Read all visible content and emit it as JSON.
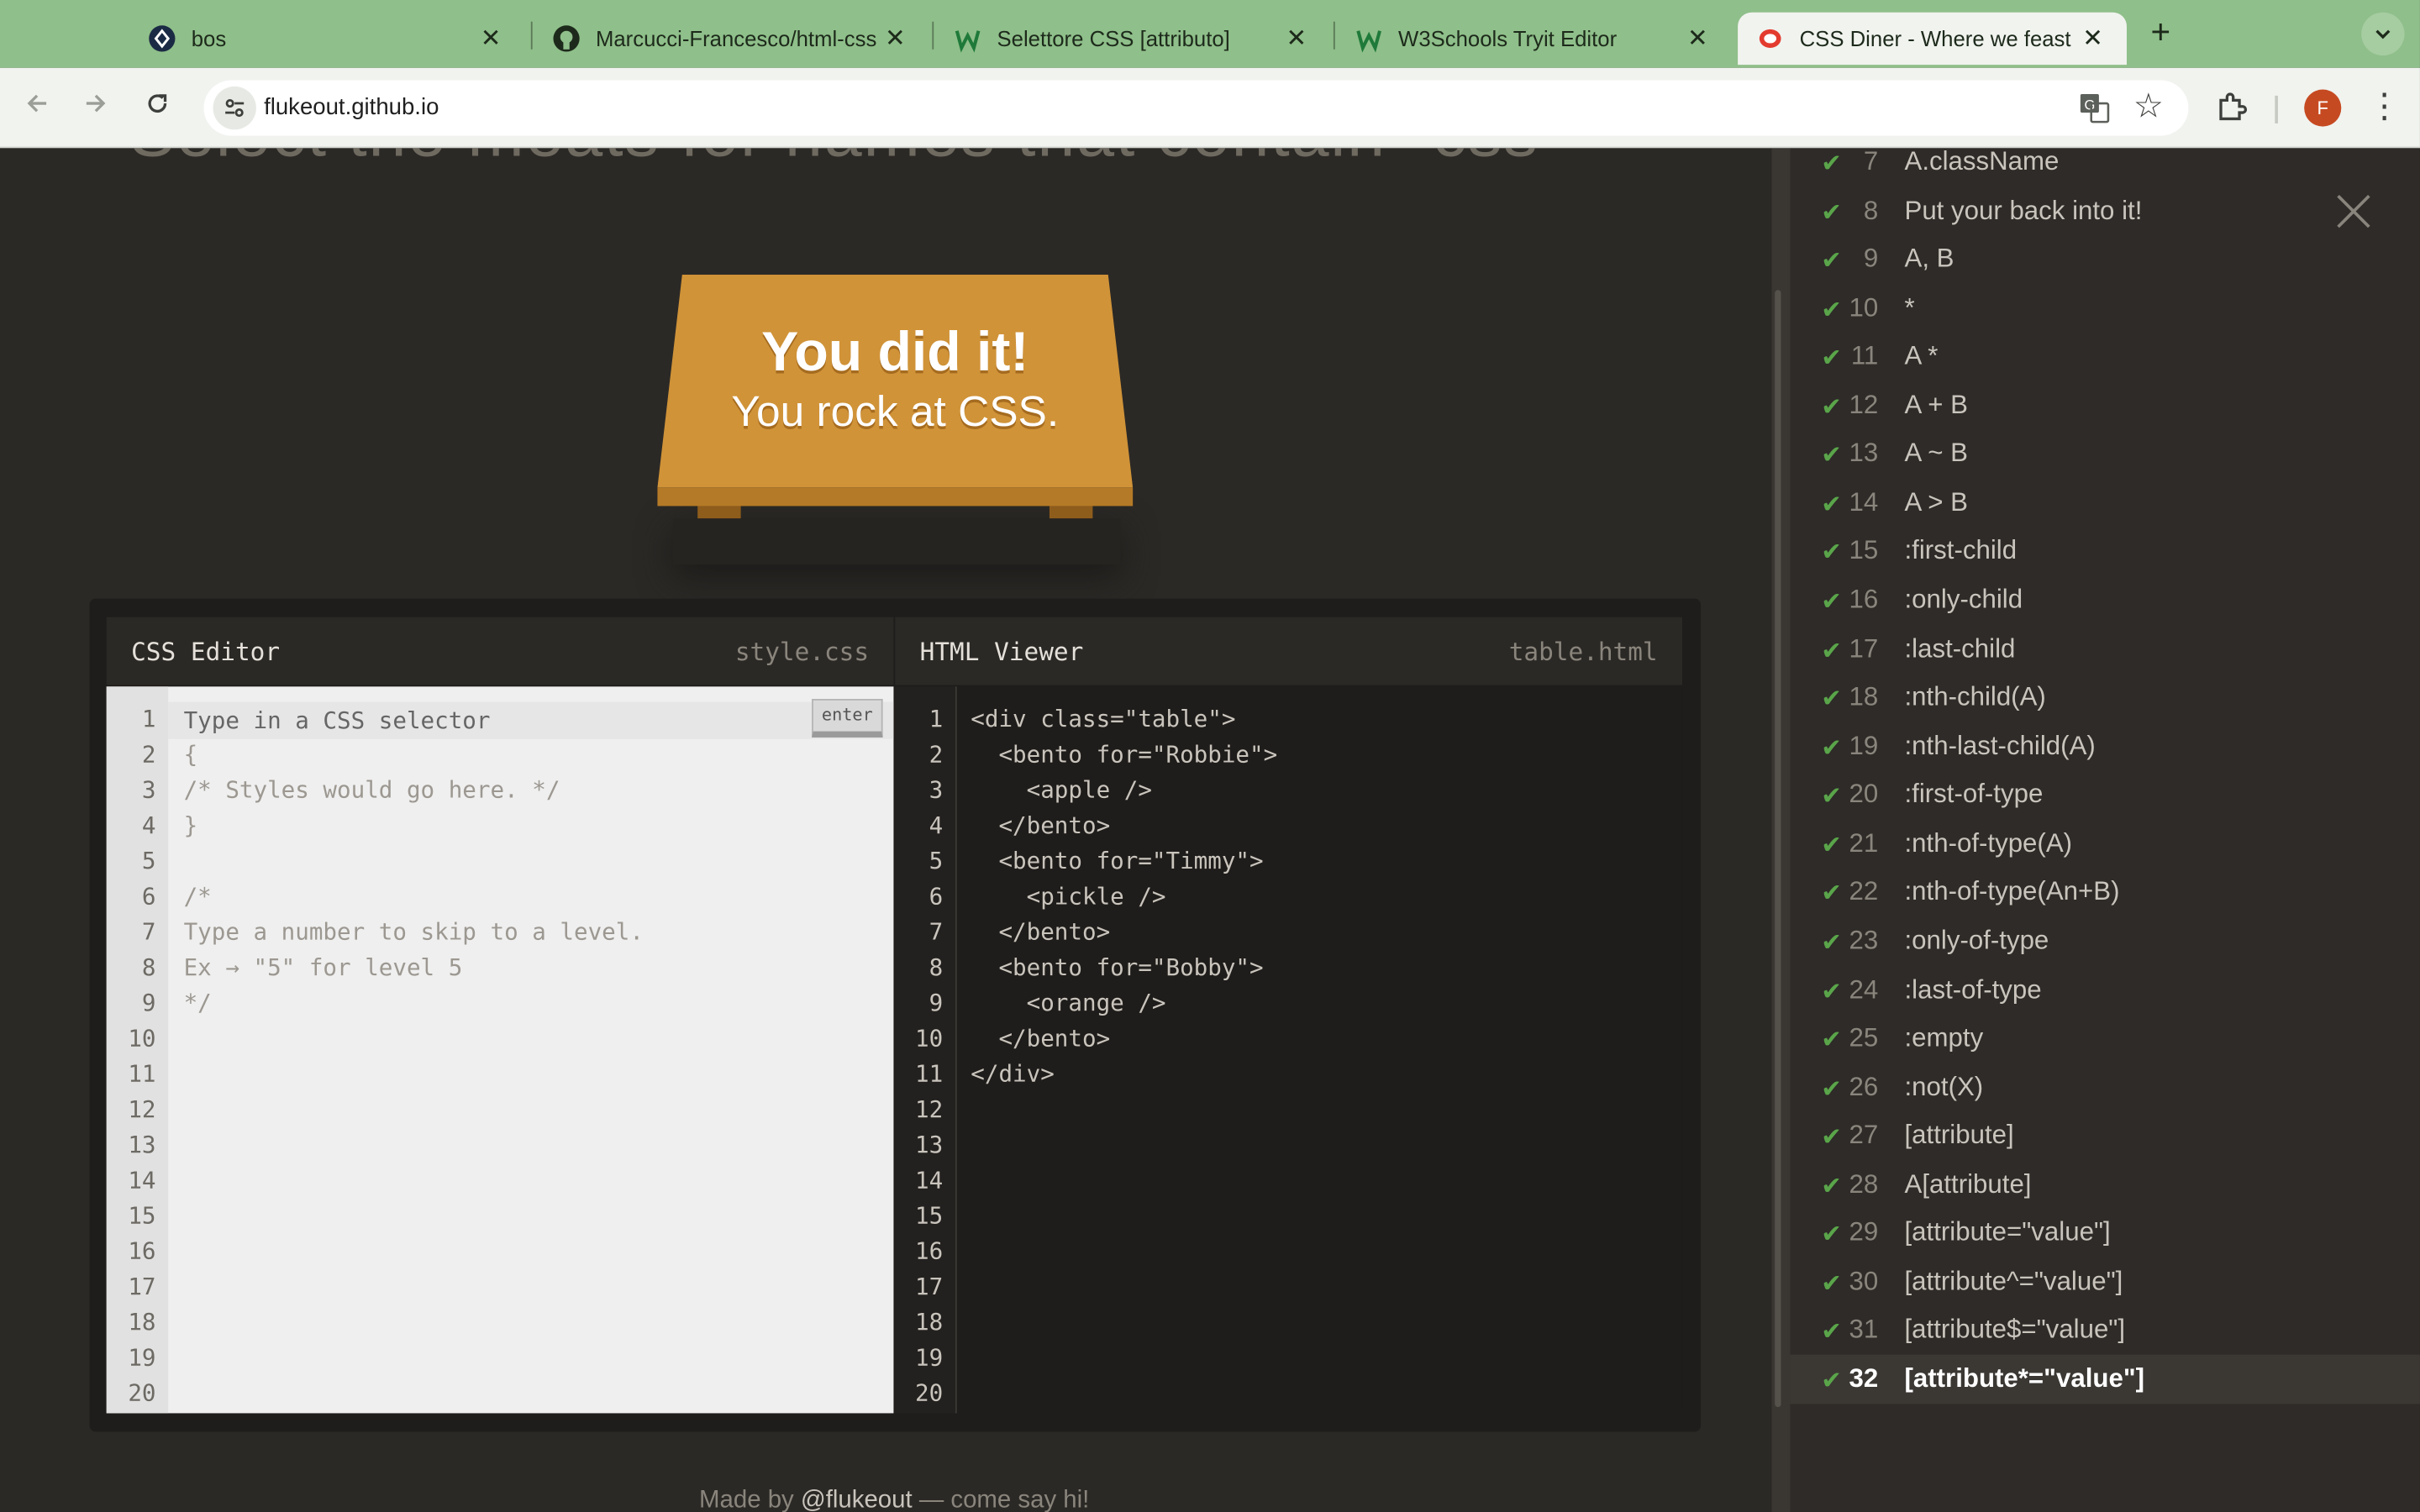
{
  "browser": {
    "tabs": [
      {
        "title": "bos",
        "active": false,
        "favicon": "bos-diamond-icon"
      },
      {
        "title": "Marcucci-Francesco/html-css",
        "active": false,
        "favicon": "github-icon"
      },
      {
        "title": "Selettore CSS [attributo]",
        "active": false,
        "favicon": "w3schools-icon"
      },
      {
        "title": "W3Schools Tryit Editor",
        "active": false,
        "favicon": "w3schools-icon"
      },
      {
        "title": "CSS Diner - Where we feast on",
        "active": true,
        "favicon": "css-diner-icon"
      }
    ],
    "close_glyph": "✕",
    "new_tab_glyph": "+",
    "url": "flukeout.github.io",
    "avatar_initial": "F",
    "colors": {
      "tabstrip": "#8fbf8a",
      "toolbar": "#f1f3ef",
      "avatar": "#c64a21"
    }
  },
  "page": {
    "order_instruction": "Select the meats for names that contain \"css\"",
    "table": {
      "line1": "You did it!",
      "line2": "You rock at CSS."
    },
    "css_editor": {
      "title": "CSS Editor",
      "filename": "style.css",
      "input_placeholder": "Type in a CSS selector",
      "enter_label": "enter",
      "lines": [
        "",
        "{",
        "/* Styles would go here. */",
        "}",
        "",
        "/*",
        "Type a number to skip to a level.",
        "Ex → \"5\" for level 5",
        "*/"
      ],
      "line_count": 20
    },
    "html_viewer": {
      "title": "HTML Viewer",
      "filename": "table.html",
      "lines": [
        "<div class=\"table\">",
        "  <bento for=\"Robbie\">",
        "    <apple />",
        "  </bento>",
        "  <bento for=\"Timmy\">",
        "    <pickle />",
        "  </bento>",
        "  <bento for=\"Bobby\">",
        "    <orange />",
        "  </bento>",
        "</div>"
      ],
      "line_count": 20
    },
    "footer": {
      "prefix": "Made by ",
      "author": "@flukeout",
      "suffix": " — come say hi!"
    }
  },
  "levels": {
    "current": 32,
    "items": [
      {
        "num": "7",
        "name": "A.className",
        "done": true
      },
      {
        "num": "8",
        "name": "Put your back into it!",
        "done": true
      },
      {
        "num": "9",
        "name": "A, B",
        "done": true
      },
      {
        "num": "10",
        "name": "*",
        "done": true
      },
      {
        "num": "11",
        "name": "A *",
        "done": true
      },
      {
        "num": "12",
        "name": "A + B",
        "done": true
      },
      {
        "num": "13",
        "name": "A ~ B",
        "done": true
      },
      {
        "num": "14",
        "name": "A > B",
        "done": true
      },
      {
        "num": "15",
        "name": ":first-child",
        "done": true
      },
      {
        "num": "16",
        "name": ":only-child",
        "done": true
      },
      {
        "num": "17",
        "name": ":last-child",
        "done": true
      },
      {
        "num": "18",
        "name": ":nth-child(A)",
        "done": true
      },
      {
        "num": "19",
        "name": ":nth-last-child(A)",
        "done": true
      },
      {
        "num": "20",
        "name": ":first-of-type",
        "done": true
      },
      {
        "num": "21",
        "name": ":nth-of-type(A)",
        "done": true
      },
      {
        "num": "22",
        "name": ":nth-of-type(An+B)",
        "done": true
      },
      {
        "num": "23",
        "name": ":only-of-type",
        "done": true
      },
      {
        "num": "24",
        "name": ":last-of-type",
        "done": true
      },
      {
        "num": "25",
        "name": ":empty",
        "done": true
      },
      {
        "num": "26",
        "name": ":not(X)",
        "done": true
      },
      {
        "num": "27",
        "name": "[attribute]",
        "done": true
      },
      {
        "num": "28",
        "name": "A[attribute]",
        "done": true
      },
      {
        "num": "29",
        "name": "[attribute=\"value\"]",
        "done": true
      },
      {
        "num": "30",
        "name": "[attribute^=\"value\"]",
        "done": true
      },
      {
        "num": "31",
        "name": "[attribute$=\"value\"]",
        "done": true
      },
      {
        "num": "32",
        "name": "[attribute*=\"value\"]",
        "done": true
      }
    ],
    "check_glyph": "✔",
    "check_color": "#5aa54a"
  }
}
